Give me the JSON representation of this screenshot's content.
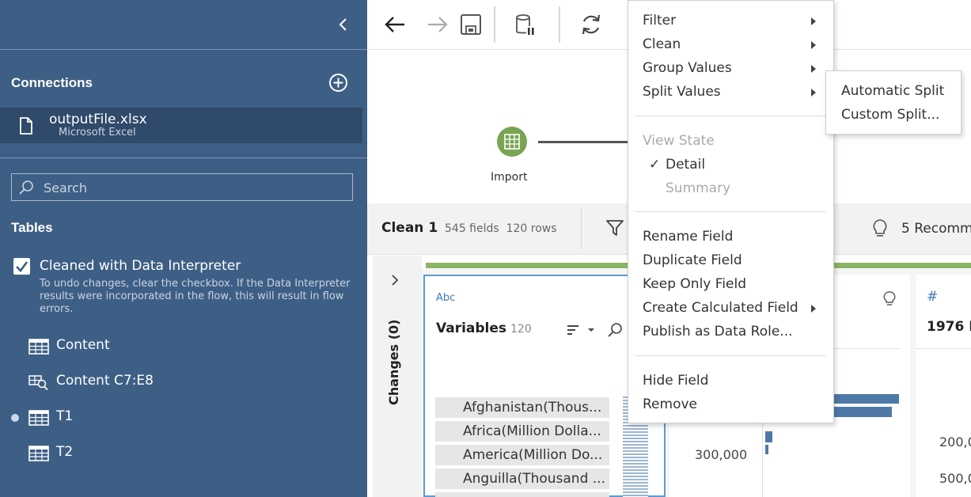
{
  "sidebar": {
    "connections_heading": "Connections",
    "connection": {
      "name": "outputFile.xlsx",
      "type": "Microsoft Excel"
    },
    "search_placeholder": "Search",
    "tables_heading": "Tables",
    "interpreter": {
      "label": "Cleaned with Data Interpreter",
      "checked": true,
      "note": "To undo changes, clear the checkbox. If the Data Interpreter results were incorporated in the flow, this will result in flow errors."
    },
    "tables": [
      {
        "label": "Content",
        "icon": "table-icon"
      },
      {
        "label": "Content C7:E8",
        "icon": "named-range-icon"
      },
      {
        "label": "T1",
        "icon": "table-icon",
        "in_use": true
      },
      {
        "label": "T2",
        "icon": "table-icon"
      }
    ]
  },
  "toolbar": {
    "icons": [
      "back-arrow-icon",
      "forward-arrow-icon",
      "save-icon",
      "data-source-pause-icon",
      "refresh-icon"
    ]
  },
  "flow": {
    "steps": [
      {
        "label": "Import",
        "icon": "input-table-icon",
        "color": "#79a451"
      }
    ]
  },
  "clean_step": {
    "title": "Clean 1",
    "fields": "545 fields",
    "rows": "120 rows",
    "recommendations": "5 Recomm"
  },
  "changes_panel": {
    "label": "Changes (0)"
  },
  "profile": {
    "variables_card": {
      "type_label": "Abc",
      "title": "Variables",
      "count": "120",
      "values": [
        "Afghanistan(Thous...",
        "Africa(Million Dolla...",
        "America(Million Do...",
        "Anguilla(Thousand ..."
      ]
    },
    "numeric_card": {
      "axis_label": "300,000"
    },
    "third_card": {
      "type_label": "#",
      "title": "1976 F",
      "axis_labels": [
        "200,0",
        "500,0"
      ]
    }
  },
  "context_menu": {
    "filter": "Filter",
    "clean": "Clean",
    "group_values": "Group Values",
    "split_values": "Split Values",
    "view_state": "View State",
    "detail": "Detail",
    "summary": "Summary",
    "rename": "Rename Field",
    "duplicate": "Duplicate Field",
    "keep_only": "Keep Only Field",
    "create_calc": "Create Calculated Field",
    "publish": "Publish as Data Role...",
    "hide": "Hide Field",
    "remove": "Remove",
    "split_submenu": {
      "automatic": "Automatic Split",
      "custom": "Custom Split..."
    }
  },
  "colors": {
    "sidebar_bg": "#3e5f85",
    "accent_green": "#79a451",
    "bar_blue": "#4e79a7",
    "selection_blue": "#5b9bd5"
  }
}
